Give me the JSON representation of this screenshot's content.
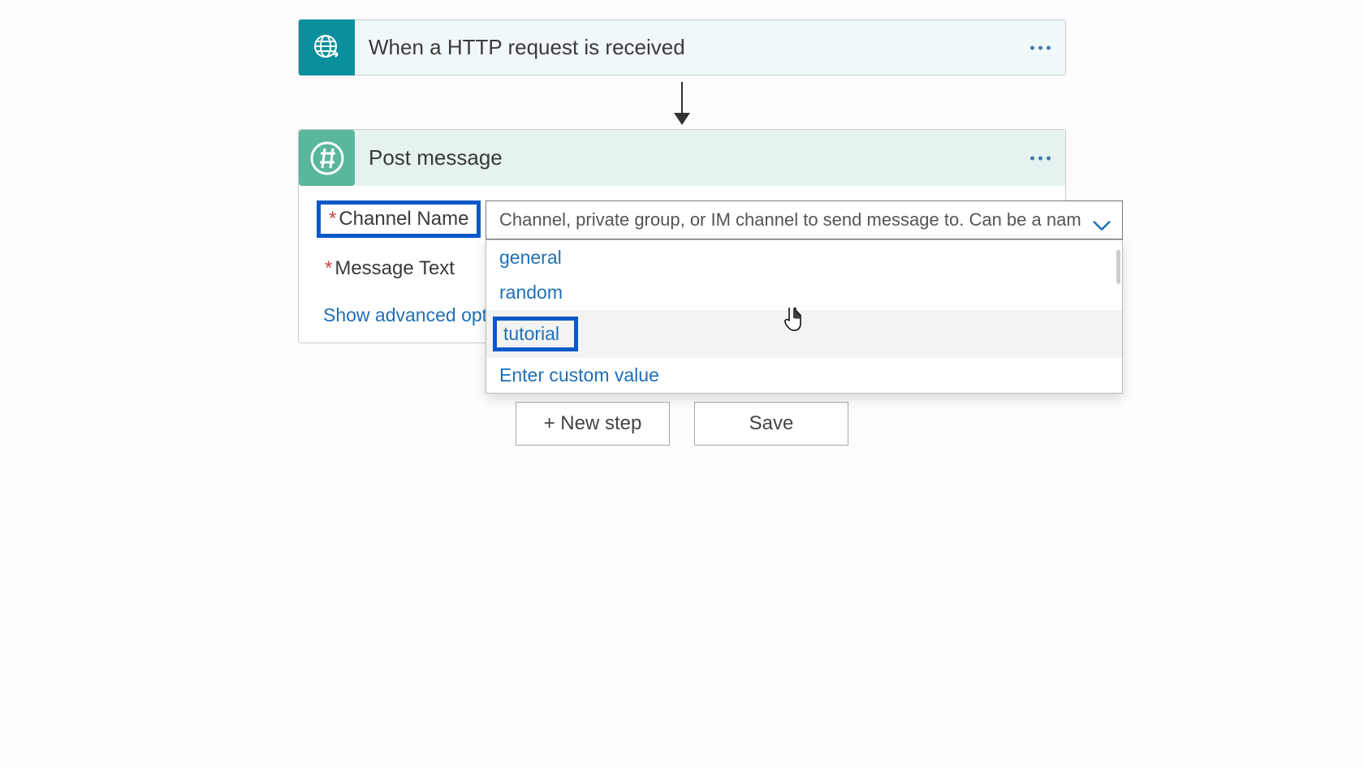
{
  "trigger": {
    "title": "When a HTTP request is received"
  },
  "action": {
    "title": "Post message",
    "fields": {
      "channel_label": "Channel Name",
      "channel_placeholder": "Channel, private group, or IM channel to send message to. Can be a nam",
      "message_label": "Message Text"
    },
    "dropdown_options": {
      "opt0": "general",
      "opt1": "random",
      "opt2": "tutorial",
      "opt3": "Enter custom value"
    },
    "advanced_link": "Show advanced options"
  },
  "buttons": {
    "new_step": "+ New step",
    "save": "Save"
  }
}
